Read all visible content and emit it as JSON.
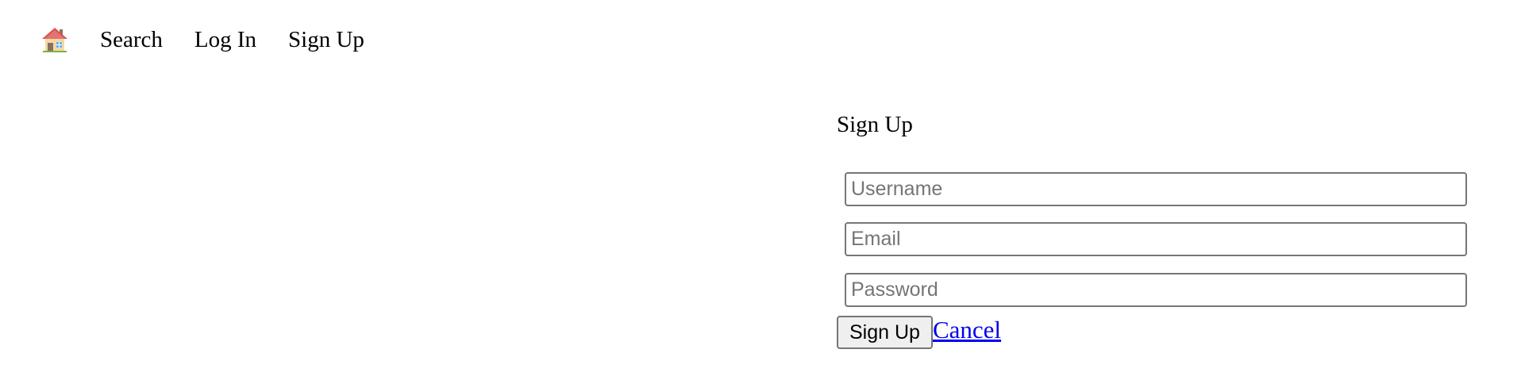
{
  "nav": {
    "home_icon": "house-emoji-icon",
    "items": [
      {
        "label": "Search"
      },
      {
        "label": "Log In"
      },
      {
        "label": "Sign Up"
      }
    ]
  },
  "form": {
    "title": "Sign Up",
    "username_placeholder": "Username",
    "username_value": "",
    "email_placeholder": "Email",
    "email_value": "",
    "password_placeholder": "Password",
    "password_value": "",
    "submit_label": "Sign Up",
    "cancel_label": "Cancel"
  },
  "colors": {
    "link": "#0000ee",
    "border": "#767676",
    "button_bg": "#efefef",
    "placeholder": "#757575"
  }
}
